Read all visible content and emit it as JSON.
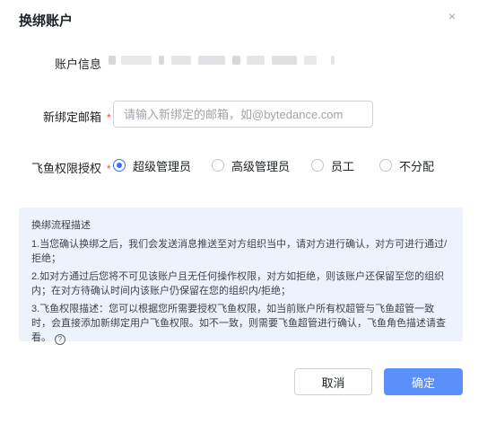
{
  "dialog": {
    "title": "换绑账户",
    "close_symbol": "×"
  },
  "form": {
    "account_info_label": "账户信息",
    "new_email_label": "新绑定邮箱",
    "new_email_placeholder": "请输入新绑定的邮箱，如@bytedance.com",
    "new_email_value": "",
    "required_mark": "*",
    "permission_label": "飞鱼权限授权",
    "permission_options": [
      {
        "label": "超级管理员",
        "checked": true
      },
      {
        "label": "高级管理员",
        "checked": false
      },
      {
        "label": "员工",
        "checked": false
      },
      {
        "label": "不分配",
        "checked": false
      }
    ]
  },
  "info": {
    "title": "换绑流程描述",
    "paragraphs": [
      "1.当您确认换绑之后，我们会发送消息推送至对方组织当中，请对方进行确认，对方可进行通过/拒绝；",
      "2.如对方通过后您将不可见该账户且无任何操作权限，对方如拒绝，则该账户还保留至您的组织内；在对方待确认时间内该账户仍保留在您的组织内/拒绝；",
      "3.飞鱼权限描述：您可以根据您所需要授权飞鱼权限，如当前账户所有权超管与飞鱼超管一致时，会直接添加新绑定用户飞鱼权限。如不一致，则需要飞鱼超管进行确认，飞鱼角色描述请查看。"
    ],
    "help_symbol": "?"
  },
  "footer": {
    "cancel_label": "取消",
    "confirm_label": "确定"
  },
  "colors": {
    "primary": "#5b8ff9",
    "radio_checked": "#3370ff",
    "required": "#f54a45",
    "info_bg": "#eef2fd"
  }
}
